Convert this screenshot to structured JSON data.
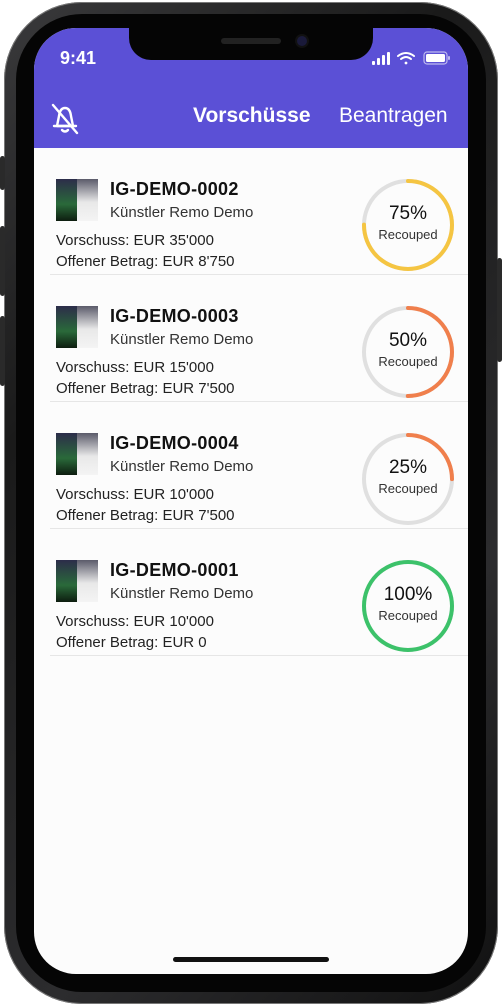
{
  "status_bar": {
    "time": "9:41"
  },
  "header": {
    "title": "Vorschüsse",
    "apply_label": "Beantragen"
  },
  "colors": {
    "header": "#5b50d6",
    "ring_track": "#e0e0e0"
  },
  "advances": [
    {
      "code": "IG-DEMO-0002",
      "artist": "Künstler Remo Demo",
      "advance": "Vorschuss: EUR 35'000",
      "open": "Offener Betrag: EUR 8'750",
      "percent_label": "75%",
      "percent": 75,
      "recouped_label": "Recouped",
      "color": "#f5c542"
    },
    {
      "code": "IG-DEMO-0003",
      "artist": "Künstler Remo Demo",
      "advance": "Vorschuss: EUR 15'000",
      "open": "Offener Betrag: EUR 7'500",
      "percent_label": "50%",
      "percent": 50,
      "recouped_label": "Recouped",
      "color": "#f07f4c"
    },
    {
      "code": "IG-DEMO-0004",
      "artist": "Künstler Remo Demo",
      "advance": "Vorschuss: EUR 10'000",
      "open": "Offener Betrag: EUR 7'500",
      "percent_label": "25%",
      "percent": 25,
      "recouped_label": "Recouped",
      "color": "#f07f4c"
    },
    {
      "code": "IG-DEMO-0001",
      "artist": "Künstler Remo Demo",
      "advance": "Vorschuss: EUR 10'000",
      "open": "Offener Betrag: EUR 0",
      "percent_label": "100%",
      "percent": 100,
      "recouped_label": "Recouped",
      "color": "#3cc26a"
    }
  ]
}
